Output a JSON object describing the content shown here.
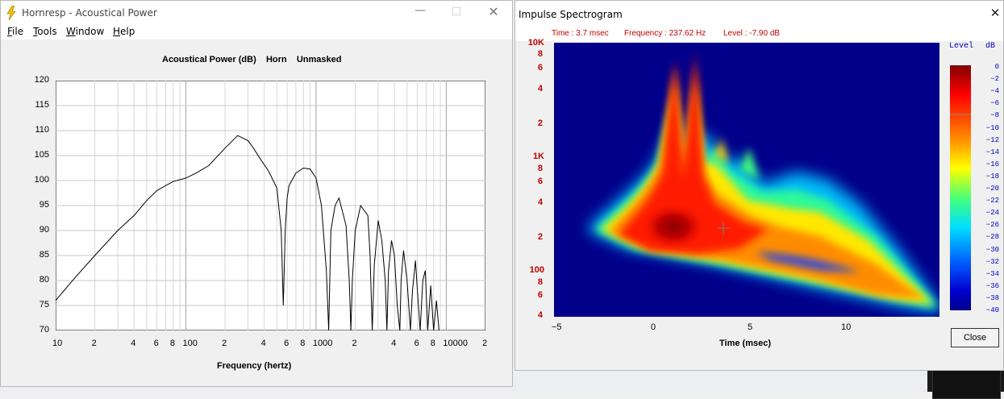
{
  "background": {
    "right_window_color": "#111111"
  },
  "hornresp": {
    "title": "Hornresp - Acoustical Power",
    "menu": [
      {
        "label": "File",
        "u": "F",
        "rest": "ile"
      },
      {
        "label": "Tools",
        "u": "T",
        "rest": "ools"
      },
      {
        "label": "Window",
        "u": "W",
        "rest": "indow"
      },
      {
        "label": "Help",
        "u": "H",
        "rest": "elp"
      }
    ],
    "plot_title": "Acoustical Power (dB)    Horn    Unmasked",
    "y_ticks": [
      "120",
      "115",
      "110",
      "105",
      "100",
      "95",
      "90",
      "85",
      "80",
      "75",
      "70"
    ],
    "x_ticks": [
      "10",
      "2",
      "4",
      "6",
      "8",
      "100",
      "2",
      "4",
      "6",
      "8",
      "1000",
      "2",
      "4",
      "6",
      "8",
      "10000",
      "2"
    ],
    "xlabel": "Frequency (hertz)"
  },
  "chart_data": {
    "type": "line",
    "title": "Acoustical Power (dB)    Horn    Unmasked",
    "xlabel": "Frequency (hertz)",
    "ylabel": "",
    "x_scale": "log",
    "xlim": [
      10,
      20000
    ],
    "ylim": [
      70,
      120
    ],
    "series": [
      {
        "x": [
          10,
          14,
          20,
          30,
          40,
          50,
          60,
          70,
          80,
          100,
          120,
          150,
          200,
          250,
          300,
          330,
          380,
          430,
          500,
          540,
          560,
          580,
          600,
          620,
          700,
          800,
          900,
          1000,
          1100,
          1200,
          1250,
          1280,
          1300,
          1400,
          1500,
          1700,
          1800,
          1850,
          1900,
          2000,
          2200,
          2500,
          2600,
          2700,
          2800,
          3000,
          3200,
          3400,
          3500,
          3600,
          3800,
          4000,
          4200,
          4400,
          4500,
          4700,
          5000,
          5300,
          5500,
          5800,
          6000,
          6300,
          6600,
          6900,
          7200,
          7600,
          8000,
          8400,
          8800
        ],
        "values": [
          76,
          80.5,
          85,
          90,
          93,
          96,
          98,
          99,
          99.8,
          100.5,
          101.5,
          103,
          106.5,
          109,
          108,
          106.5,
          104,
          102,
          98.5,
          90,
          75,
          90,
          96.5,
          99,
          101.5,
          102.5,
          102.3,
          100.5,
          95,
          82,
          70,
          82,
          90,
          95,
          96.5,
          91,
          80,
          70,
          80,
          90,
          95,
          93,
          85,
          70,
          83,
          92,
          88,
          80,
          70,
          82,
          88,
          85,
          75,
          70,
          80,
          86,
          80,
          70,
          78,
          84,
          78,
          70,
          80,
          82,
          70,
          79,
          70,
          76,
          70
        ]
      }
    ]
  },
  "spectrogram": {
    "title": "Impulse Spectrogram",
    "info_time": "Time : 3.7 msec",
    "info_freq": "Frequency : 237.62 Hz",
    "info_level": "Level : -7.90 dB",
    "f_ticks": [
      "10K",
      "8",
      "6",
      "4",
      "2",
      "1K",
      "8",
      "6",
      "4",
      "2",
      "100",
      "8",
      "6",
      "4"
    ],
    "t_ticks": [
      "−5",
      "0",
      "5",
      "10"
    ],
    "tlabel": "Time (msec)",
    "colorbar_title": "Level",
    "colorbar_unit": "dB",
    "colorbar_ticks": [
      "0",
      "−2",
      "−4",
      "−6",
      "−8",
      "−10",
      "−12",
      "−14",
      "−16",
      "−18",
      "−20",
      "−22",
      "−24",
      "−26",
      "−28",
      "−30",
      "−32",
      "−34",
      "−36",
      "−38",
      "−40"
    ],
    "close_label": "Close",
    "close_icon": "close-icon"
  }
}
